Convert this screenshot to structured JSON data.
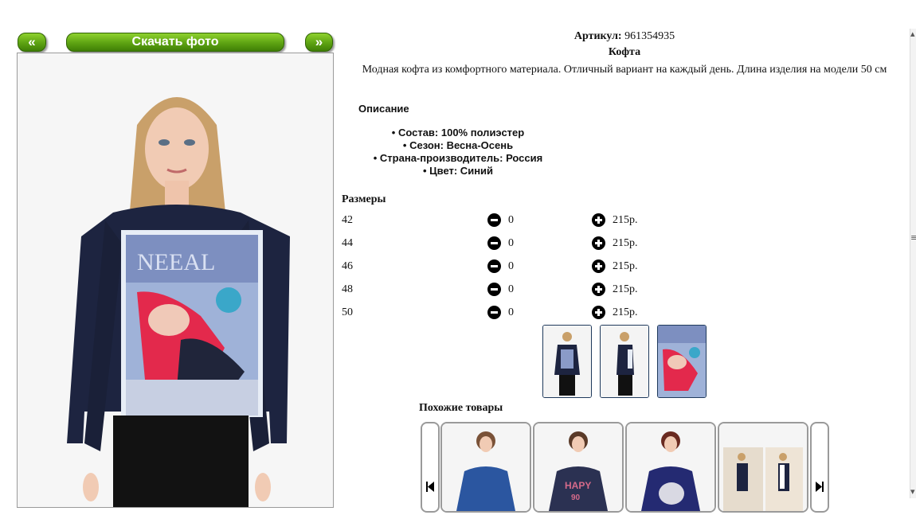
{
  "gallery": {
    "prev_label": "«",
    "download_label": "Скачать фото",
    "next_label": "»"
  },
  "product": {
    "article_label": "Артикул:",
    "article_value": "961354935",
    "title": "Кофта",
    "description": "Модная кофта из комфортного материала. Отличный вариант на каждый день. Длина изделия на модели 50 см"
  },
  "details": {
    "heading": "Описание",
    "properties": [
      "Состав: 100% полиэстер",
      "Сезон: Весна-Осень",
      "Страна-производитель: Россия",
      "Цвет: Синий"
    ]
  },
  "sizes": {
    "heading": "Размеры",
    "rows": [
      {
        "size": "42",
        "qty": "0",
        "price": "215р."
      },
      {
        "size": "44",
        "qty": "0",
        "price": "215р."
      },
      {
        "size": "46",
        "qty": "0",
        "price": "215р."
      },
      {
        "size": "48",
        "qty": "0",
        "price": "215р."
      },
      {
        "size": "50",
        "qty": "0",
        "price": "215р."
      }
    ]
  },
  "similar": {
    "heading": "Похожие товары"
  },
  "colors": {
    "button_green": "#5da312",
    "top_navy": "#1d2440",
    "thumb_border": "#1f3a5c"
  }
}
